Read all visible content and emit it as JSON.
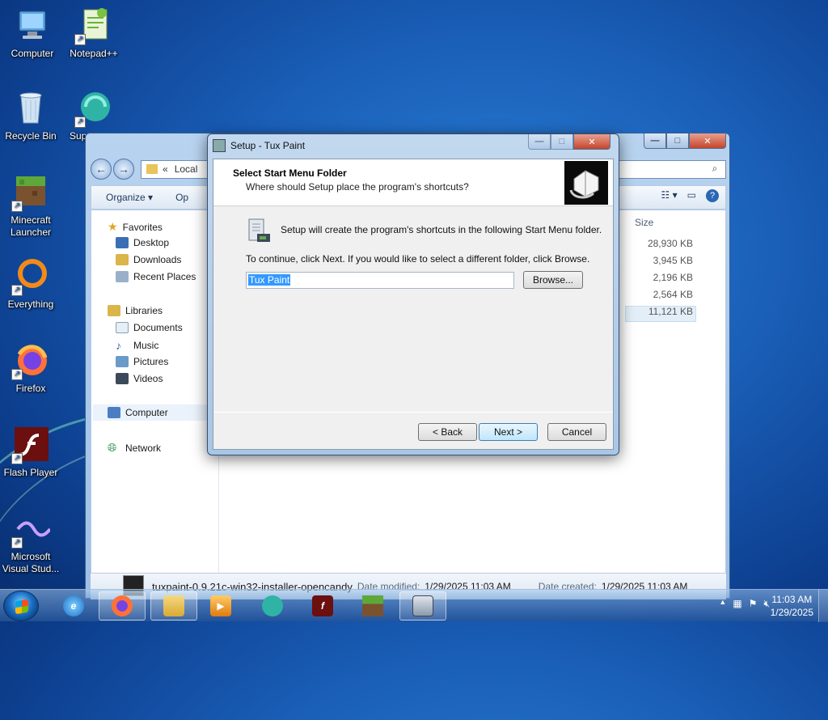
{
  "desktop": {
    "icons": [
      {
        "label": "Computer",
        "icon": "computer-icon"
      },
      {
        "label": "Notepad++",
        "icon": "notepadpp-icon"
      },
      {
        "label": "Recycle Bin",
        "icon": "recycle-bin-icon"
      },
      {
        "label": "Sup",
        "icon": "support-icon"
      },
      {
        "label": "Minecraft Launcher",
        "icon": "minecraft-icon"
      },
      {
        "label": "Everything",
        "icon": "everything-icon"
      },
      {
        "label": "Firefox",
        "icon": "firefox-icon"
      },
      {
        "label": "Flash Player",
        "icon": "flash-icon"
      },
      {
        "label": "Microsoft Visual Stud...",
        "icon": "vstudio-icon"
      }
    ]
  },
  "explorer": {
    "address_prefix": "«",
    "address_text": "Local",
    "organize_label": "Organize ▾",
    "open_label": "Op",
    "nav": {
      "favorites": "Favorites",
      "desktop": "Desktop",
      "downloads": "Downloads",
      "recent": "Recent Places",
      "libraries": "Libraries",
      "documents": "Documents",
      "music": "Music",
      "pictures": "Pictures",
      "videos": "Videos",
      "computer": "Computer",
      "network": "Network"
    },
    "size_header": "Size",
    "sizes": [
      "28,930 KB",
      "3,945 KB",
      "2,196 KB",
      "2,564 KB",
      "11,121 KB"
    ],
    "details": {
      "filename": "tuxpaint-0.9.21c-win32-installer-opencandy",
      "date_modified_label": "Date modified:",
      "date_modified": "1/29/2025 11:03 AM",
      "date_created_label": "Date created:",
      "date_created": "1/29/2025 11:03 AM"
    }
  },
  "setup": {
    "title": "Setup - Tux Paint",
    "header_title": "Select Start Menu Folder",
    "header_subtitle": "Where should Setup place the program's shortcuts?",
    "info_text": "Setup will create the program's shortcuts in the following Start Menu folder.",
    "instruction_text": "To continue, click Next. If you would like to select a different folder, click Browse.",
    "folder_value": "Tux Paint",
    "browse_label": "Browse...",
    "back_label": "< Back",
    "next_label": "Next >",
    "cancel_label": "Cancel"
  },
  "taskbar": {
    "clock_time": "11:03 AM",
    "clock_date": "1/29/2025",
    "tray_arrow": "▲"
  }
}
